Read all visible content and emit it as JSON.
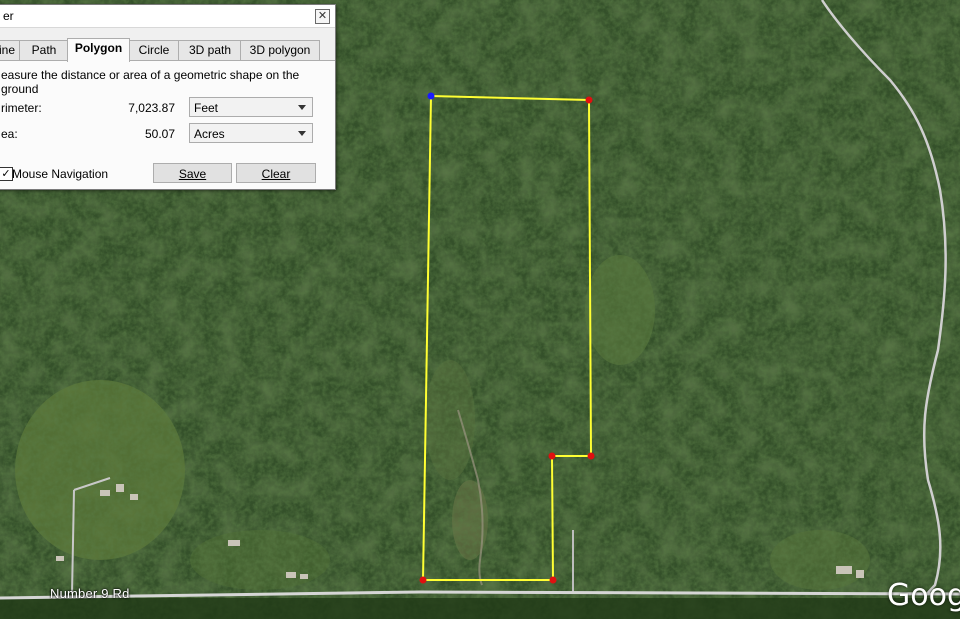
{
  "ruler": {
    "title": "er",
    "close_glyph": "✕",
    "tabs": [
      "ine",
      "Path",
      "Polygon",
      "Circle",
      "3D path",
      "3D polygon"
    ],
    "active_tab": "Polygon",
    "description": "easure the distance or area of a geometric shape on the ground",
    "perimeter_label": "rimeter:",
    "perimeter_value": "7,023.87",
    "perimeter_unit": "Feet",
    "area_label": "ea:",
    "area_value": "50.07",
    "area_unit": "Acres",
    "mouse_nav_checked": true,
    "mouse_nav_label": "Mouse Navigation",
    "save_label": "Save",
    "clear_label": "Clear"
  },
  "map": {
    "road_label": "Number 9 Rd",
    "logo_text": "Goog",
    "polygon_color": "#ffff33",
    "start_vertex_color": "#1a1aff",
    "vertex_color": "#e01010"
  }
}
